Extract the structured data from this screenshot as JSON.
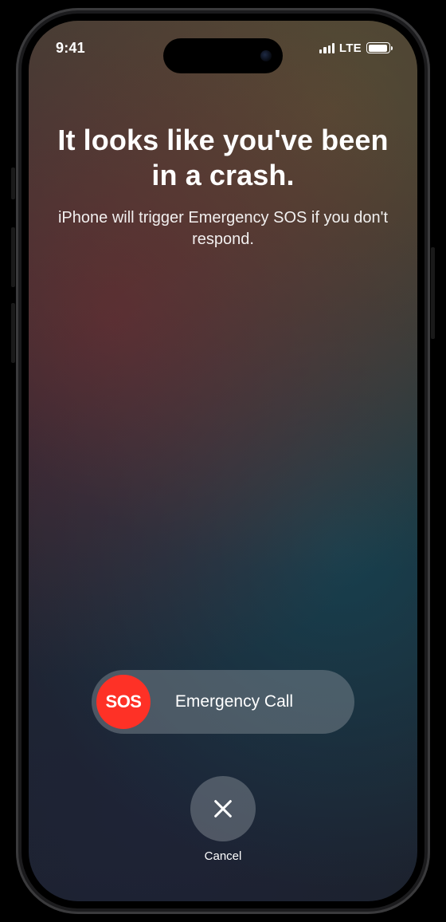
{
  "statusbar": {
    "time": "9:41",
    "network_label": "LTE"
  },
  "title": "It looks like you've been in a crash.",
  "subtitle": "iPhone will trigger Emergency SOS if you don't respond.",
  "slider": {
    "knob_text": "SOS",
    "label": "Emergency Call"
  },
  "cancel": {
    "label": "Cancel",
    "icon_name": "close-icon"
  },
  "colors": {
    "sos_red": "#fe3126"
  }
}
